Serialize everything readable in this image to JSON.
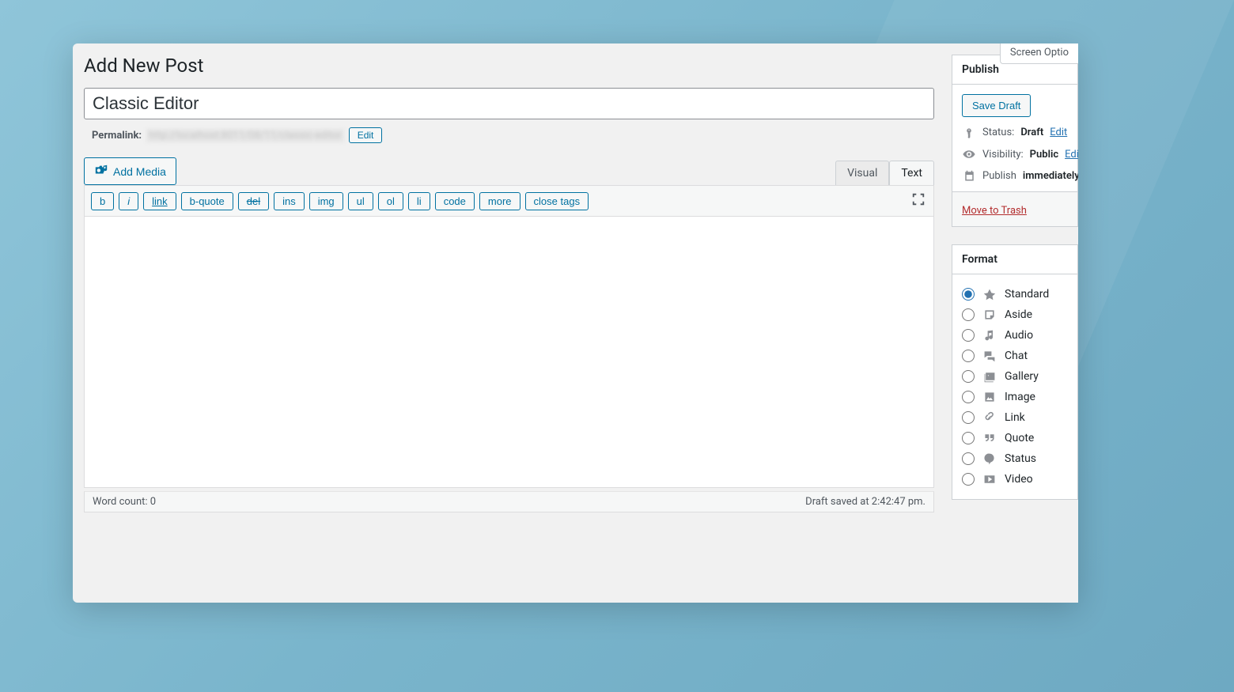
{
  "header": {
    "screen_options_label": "Screen Optio",
    "page_title": "Add New Post"
  },
  "post": {
    "title_value": "Classic Editor",
    "permalink_label": "Permalink:",
    "permalink_url": "http://localhost:8011/08/11/classic-editor",
    "permalink_edit": "Edit"
  },
  "editor": {
    "add_media": "Add Media",
    "tabs": {
      "visual": "Visual",
      "text": "Text",
      "active": "text"
    },
    "quicktags": [
      "b",
      "i",
      "link",
      "b-quote",
      "del",
      "ins",
      "img",
      "ul",
      "ol",
      "li",
      "code",
      "more",
      "close tags"
    ],
    "content": "",
    "word_count_label": "Word count:",
    "word_count_value": "0",
    "autosave_status": "Draft saved at 2:42:47 pm."
  },
  "publish": {
    "panel_title": "Publish",
    "save_draft": "Save Draft",
    "status_label": "Status:",
    "status_value": "Draft",
    "status_edit": "Edit",
    "visibility_label": "Visibility:",
    "visibility_value": "Public",
    "visibility_edit": "Edit",
    "publish_label": "Publish",
    "publish_value": "immediately",
    "trash": "Move to Trash"
  },
  "format": {
    "panel_title": "Format",
    "options": [
      {
        "key": "standard",
        "label": "Standard",
        "checked": true
      },
      {
        "key": "aside",
        "label": "Aside",
        "checked": false
      },
      {
        "key": "audio",
        "label": "Audio",
        "checked": false
      },
      {
        "key": "chat",
        "label": "Chat",
        "checked": false
      },
      {
        "key": "gallery",
        "label": "Gallery",
        "checked": false
      },
      {
        "key": "image",
        "label": "Image",
        "checked": false
      },
      {
        "key": "link",
        "label": "Link",
        "checked": false
      },
      {
        "key": "quote",
        "label": "Quote",
        "checked": false
      },
      {
        "key": "status",
        "label": "Status",
        "checked": false
      },
      {
        "key": "video",
        "label": "Video",
        "checked": false
      }
    ]
  }
}
